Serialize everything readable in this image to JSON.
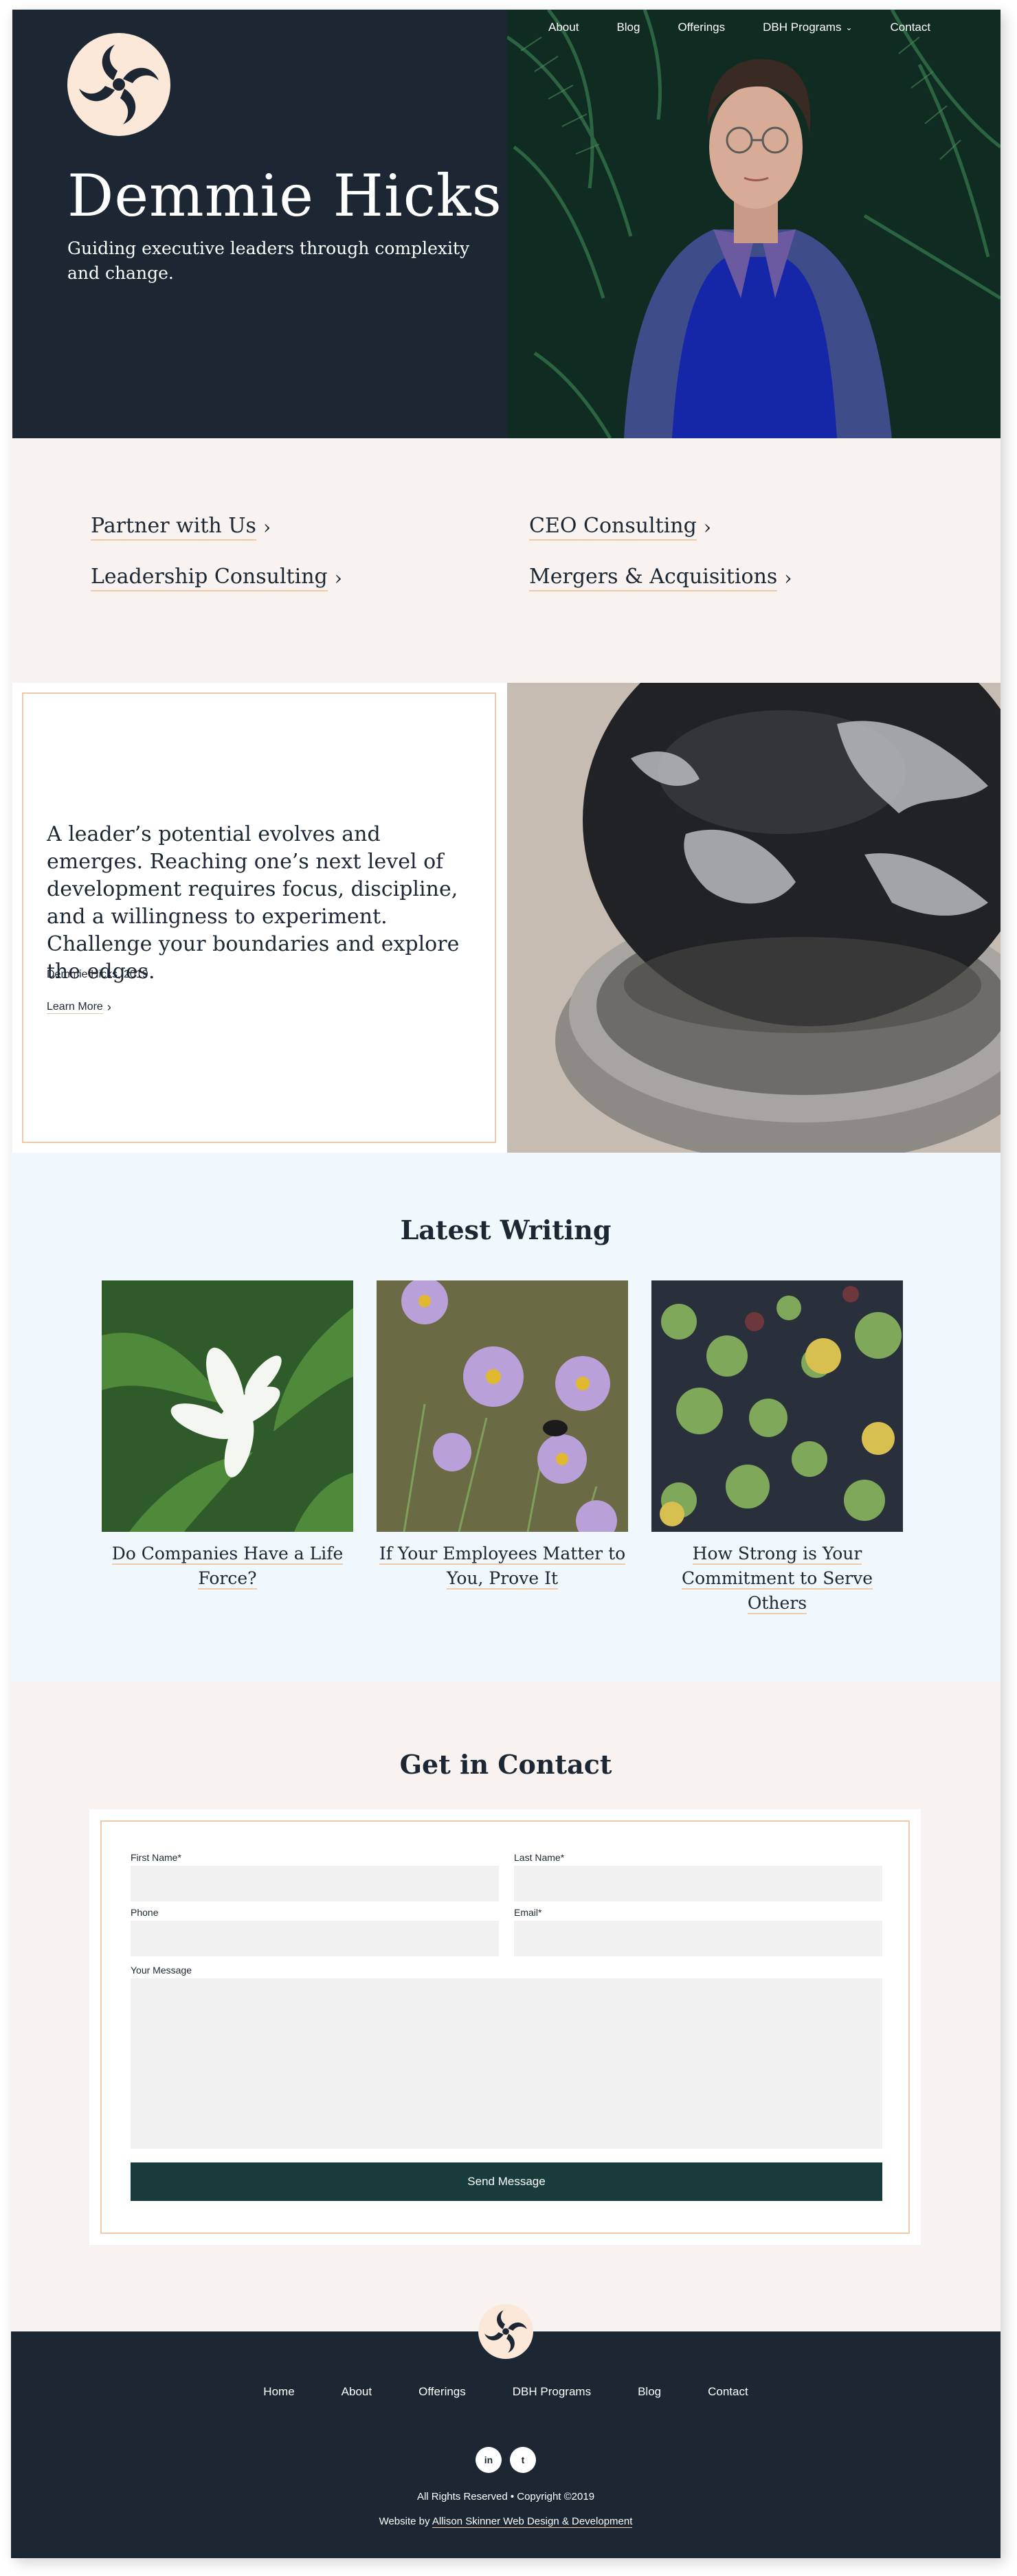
{
  "colors": {
    "navy": "#1c2733",
    "cream": "#f8f3f0",
    "accent_underline": "#f0c9a6",
    "light_blue": "#f0f8fd",
    "button": "#173c3b",
    "logo_bg": "#fbe8d8"
  },
  "nav": {
    "items": [
      {
        "label": "About"
      },
      {
        "label": "Blog"
      },
      {
        "label": "Offerings"
      },
      {
        "label": "DBH Programs",
        "has_dropdown": true
      },
      {
        "label": "Contact"
      }
    ]
  },
  "hero": {
    "name": "Demmie Hicks",
    "tagline": "Guiding executive leaders through complexity and change."
  },
  "services": {
    "items": [
      {
        "label": "Partner with Us"
      },
      {
        "label": "CEO Consulting"
      },
      {
        "label": "Leadership Consulting"
      },
      {
        "label": "Mergers & Acquisitions"
      }
    ]
  },
  "quote": {
    "text": "A leader’s potential evolves and emerges. Reaching one’s next level of development requires focus, discipline, and a willingness to experiment.  Challenge your boundaries and explore the edges.",
    "author": "Demmie Hicks, 2019",
    "link_label": "Learn More"
  },
  "writing": {
    "title": "Latest Writing",
    "posts": [
      {
        "title": "Do Companies Have a Life Force?"
      },
      {
        "title": "If Your Employees Matter to You, Prove It"
      },
      {
        "title": "How Strong is Your Commitment to Serve Others"
      }
    ]
  },
  "contact": {
    "title": "Get in Contact",
    "fields": {
      "first_name": "First Name*",
      "last_name": "Last Name*",
      "phone": "Phone",
      "email": "Email*",
      "message": "Your Message"
    },
    "submit_label": "Send Message"
  },
  "footer": {
    "nav": [
      {
        "label": "Home"
      },
      {
        "label": "About"
      },
      {
        "label": "Offerings"
      },
      {
        "label": "DBH Programs"
      },
      {
        "label": "Blog"
      },
      {
        "label": "Contact"
      }
    ],
    "social": [
      {
        "label": "in",
        "icon": "linkedin-icon"
      },
      {
        "label": "t",
        "icon": "twitter-icon"
      }
    ],
    "copyright": "All Rights Reserved • Copyright ©2019",
    "credit_prefix": "Website by",
    "credit_link": "Allison Skinner Web Design & Development"
  }
}
